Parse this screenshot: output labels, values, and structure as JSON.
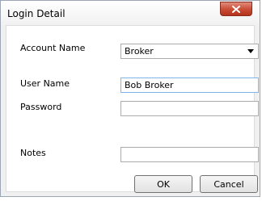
{
  "window": {
    "title": "Login Detail"
  },
  "form": {
    "account_name_label": "Account Name",
    "account_name_value": "Broker",
    "user_name_label": "User Name",
    "user_name_value": "Bob Broker",
    "password_label": "Password",
    "password_value": "",
    "notes_label": "Notes",
    "notes_value": ""
  },
  "buttons": {
    "ok": "OK",
    "cancel": "Cancel"
  },
  "icons": {
    "close": "close-icon",
    "dropdown": "chevron-down-icon"
  }
}
